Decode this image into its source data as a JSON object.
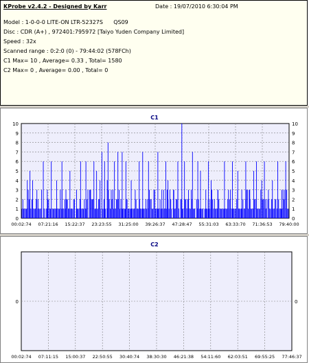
{
  "info": {
    "title": "KProbe v2.4.2 - Designed by Karr",
    "date": "Date : 19/07/2010 6:30:04 PM",
    "model": "Model : 1-0-0-0 LITE-ON LTR-52327S      QS09",
    "disc": "Disc : CDR (A+) , 972401:795972 [Taiyo Yuden Company Limited]",
    "speed": "Speed : 32x",
    "range": "Scanned range : 0:2:0 (0) - 79:44:02 (578FCh)",
    "c1_stats": "C1 Max= 10 , Average= 0.33 , Total= 1580",
    "c2_stats": "C2 Max= 0 , Average= 0.00 , Total= 0"
  },
  "colors": {
    "bar": "#0000ff",
    "plot_bg": "#eeeefc",
    "grid": "#7f7f7f",
    "title": "#000080"
  },
  "chart_data": [
    {
      "type": "bar",
      "title": "C1",
      "ylim": [
        0,
        10
      ],
      "yticks": [
        "0",
        "1",
        "2",
        "3",
        "4",
        "5",
        "6",
        "7",
        "8",
        "9",
        "10"
      ],
      "xticks": [
        "00:02:74",
        "07:21:16",
        "15:22:37",
        "23:23:55",
        "31:25:00",
        "39:26:37",
        "47:28:47",
        "55:31:03",
        "63:33:70",
        "71:36:53",
        "79:40:00"
      ],
      "grid": true,
      "spikes": [
        [
          0.02,
          4
        ],
        [
          0.03,
          5
        ],
        [
          0.04,
          4
        ],
        [
          0.08,
          6
        ],
        [
          0.11,
          6
        ],
        [
          0.13,
          4
        ],
        [
          0.15,
          6
        ],
        [
          0.18,
          5
        ],
        [
          0.22,
          6
        ],
        [
          0.24,
          6
        ],
        [
          0.27,
          6
        ],
        [
          0.28,
          5
        ],
        [
          0.3,
          7
        ],
        [
          0.31,
          6
        ],
        [
          0.32,
          4
        ],
        [
          0.347,
          6
        ],
        [
          0.36,
          7
        ],
        [
          0.376,
          7
        ],
        [
          0.39,
          6
        ],
        [
          0.41,
          4
        ],
        [
          0.44,
          6
        ],
        [
          0.475,
          6
        ],
        [
          0.51,
          7
        ],
        [
          0.54,
          6
        ],
        [
          0.548,
          4
        ],
        [
          0.585,
          6
        ],
        [
          0.6,
          10
        ],
        [
          0.61,
          6
        ],
        [
          0.64,
          7
        ],
        [
          0.66,
          6
        ],
        [
          0.67,
          5
        ],
        [
          0.7,
          6
        ],
        [
          0.71,
          4
        ],
        [
          0.76,
          6
        ],
        [
          0.79,
          6
        ],
        [
          0.81,
          5
        ],
        [
          0.84,
          6
        ],
        [
          0.87,
          5
        ],
        [
          0.88,
          6
        ],
        [
          0.91,
          6
        ],
        [
          0.94,
          4
        ],
        [
          0.96,
          6
        ],
        [
          0.99,
          6
        ],
        [
          0.323,
          8
        ],
        [
          0.453,
          7
        ],
        [
          0.056,
          3
        ],
        [
          0.095,
          3
        ],
        [
          0.165,
          3
        ],
        [
          0.205,
          3
        ],
        [
          0.255,
          3
        ],
        [
          0.293,
          4
        ],
        [
          0.335,
          3
        ],
        [
          0.425,
          3
        ],
        [
          0.495,
          3
        ],
        [
          0.525,
          3
        ],
        [
          0.57,
          3
        ],
        [
          0.625,
          3
        ],
        [
          0.69,
          3
        ],
        [
          0.735,
          3
        ],
        [
          0.775,
          3
        ],
        [
          0.825,
          3
        ],
        [
          0.855,
          3
        ],
        [
          0.9,
          4
        ],
        [
          0.925,
          3
        ],
        [
          0.975,
          3
        ]
      ]
    },
    {
      "type": "bar",
      "title": "C2",
      "ylim": [
        -1,
        1
      ],
      "yticks": [
        "0"
      ],
      "xticks": [
        "00:02:74",
        "07:11:15",
        "15:00:37",
        "22:50:55",
        "30:40:74",
        "38:30:30",
        "46:21:38",
        "54:11:60",
        "62:03:51",
        "69:55:25",
        "77:46:37"
      ],
      "grid": true,
      "values": []
    }
  ]
}
